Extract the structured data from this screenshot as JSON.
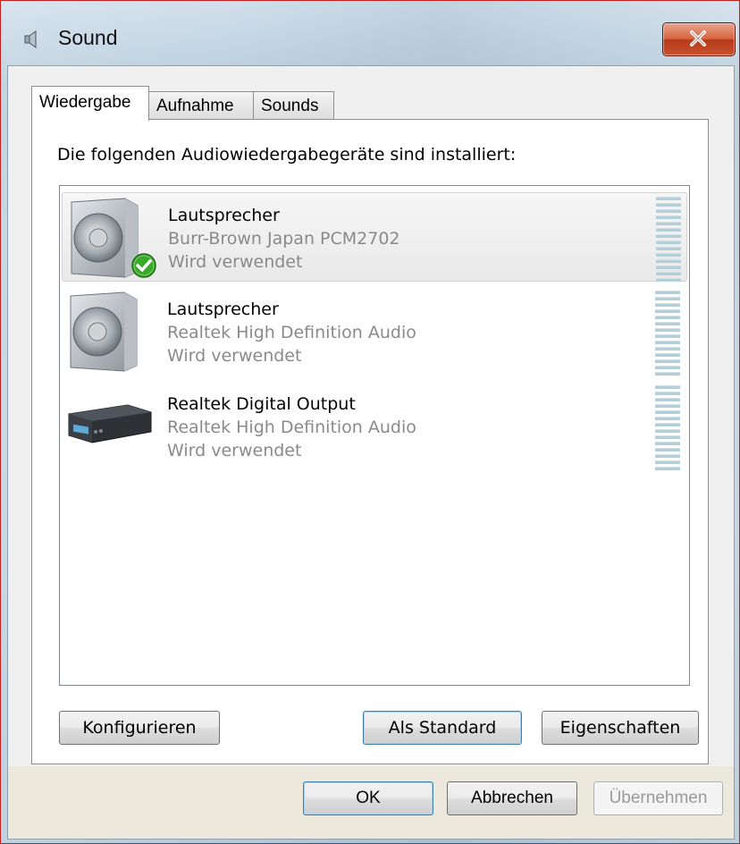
{
  "window": {
    "title": "Sound"
  },
  "tabs": [
    {
      "label": "Wiedergabe",
      "active": true
    },
    {
      "label": "Aufnahme",
      "active": false
    },
    {
      "label": "Sounds",
      "active": false
    }
  ],
  "panel": {
    "instructions": "Die folgenden Audiowiedergabegeräte sind installiert:"
  },
  "devices": [
    {
      "name": "Lautsprecher",
      "driver": "Burr-Brown Japan PCM2702",
      "status": "Wird verwendet",
      "icon": "speaker-icon",
      "default": true,
      "selected": true
    },
    {
      "name": "Lautsprecher",
      "driver": "Realtek High Definition Audio",
      "status": "Wird verwendet",
      "icon": "speaker-icon",
      "default": false,
      "selected": false
    },
    {
      "name": "Realtek Digital Output",
      "driver": "Realtek High Definition Audio",
      "status": "Wird verwendet",
      "icon": "digital-output-icon",
      "default": false,
      "selected": false
    }
  ],
  "buttons": {
    "configure": "Konfigurieren",
    "set_default": "Als Standard",
    "properties": "Eigenschaften",
    "ok": "OK",
    "cancel": "Abbrechen",
    "apply": "Übernehmen"
  },
  "colors": {
    "accent": "#3c7fb1",
    "close_button": "#c9532e",
    "default_check": "#3aa82a"
  }
}
